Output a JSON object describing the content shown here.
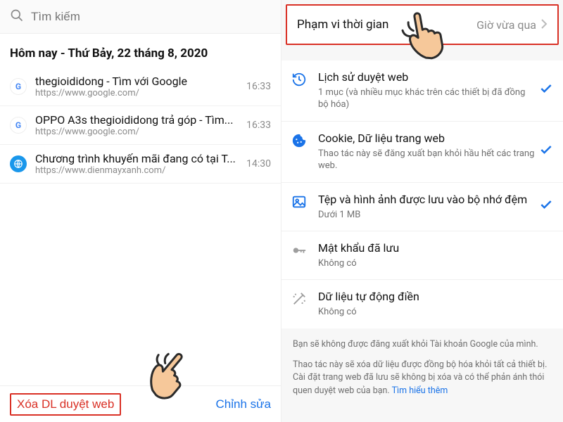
{
  "left": {
    "search_placeholder": "Tìm kiếm",
    "date_header": "Hôm nay - Thứ Bảy, 22 tháng 8, 2020",
    "history": [
      {
        "favicon": "google",
        "title": "thegioididong - Tìm với Google",
        "url": "https://www.google.com/",
        "time": "16:33"
      },
      {
        "favicon": "google",
        "title": "OPPO A3s thegioididong trả góp - Tìm...",
        "url": "https://www.google.com/",
        "time": "16:33"
      },
      {
        "favicon": "site",
        "title": "Chương trình khuyến mãi đang có tại T...",
        "url": "https://www.dienmayxanh.com/",
        "time": "14:30"
      }
    ],
    "clear_label": "Xóa DL duyệt web",
    "edit_label": "Chỉnh sửa"
  },
  "right": {
    "time_range_label": "Phạm vi thời gian",
    "time_range_value": "Giờ vừa qua",
    "options": [
      {
        "icon": "history",
        "title": "Lịch sử duyệt web",
        "sub": "1 mục (và nhiều mục khác trên các thiết bị đã đồng bộ hóa)",
        "checked": true
      },
      {
        "icon": "cookie",
        "title": "Cookie, Dữ liệu trang web",
        "sub": "Thao tác này sẽ đăng xuất bạn khỏi hầu hết các trang web.",
        "checked": true
      },
      {
        "icon": "image",
        "title": "Tệp và hình ảnh được lưu vào bộ nhớ đệm",
        "sub": "Dưới 1 MB",
        "checked": true
      },
      {
        "icon": "key",
        "title": "Mật khẩu đã lưu",
        "sub": "Không có",
        "checked": false
      },
      {
        "icon": "wand",
        "title": "Dữ liệu tự động điền",
        "sub": "Không có",
        "checked": false
      }
    ],
    "footnote1": "Bạn sẽ không được đăng xuất khỏi Tài khoản Google của mình.",
    "footnote2": "Thao tác này sẽ xóa dữ liệu được đồng bộ hóa khỏi tất cả thiết bị. Cài đặt trang web đã lưu sẽ không bị xóa và có thể phản ánh thói quen duyệt web của bạn. ",
    "learn_more": "Tìm hiểu thêm"
  }
}
